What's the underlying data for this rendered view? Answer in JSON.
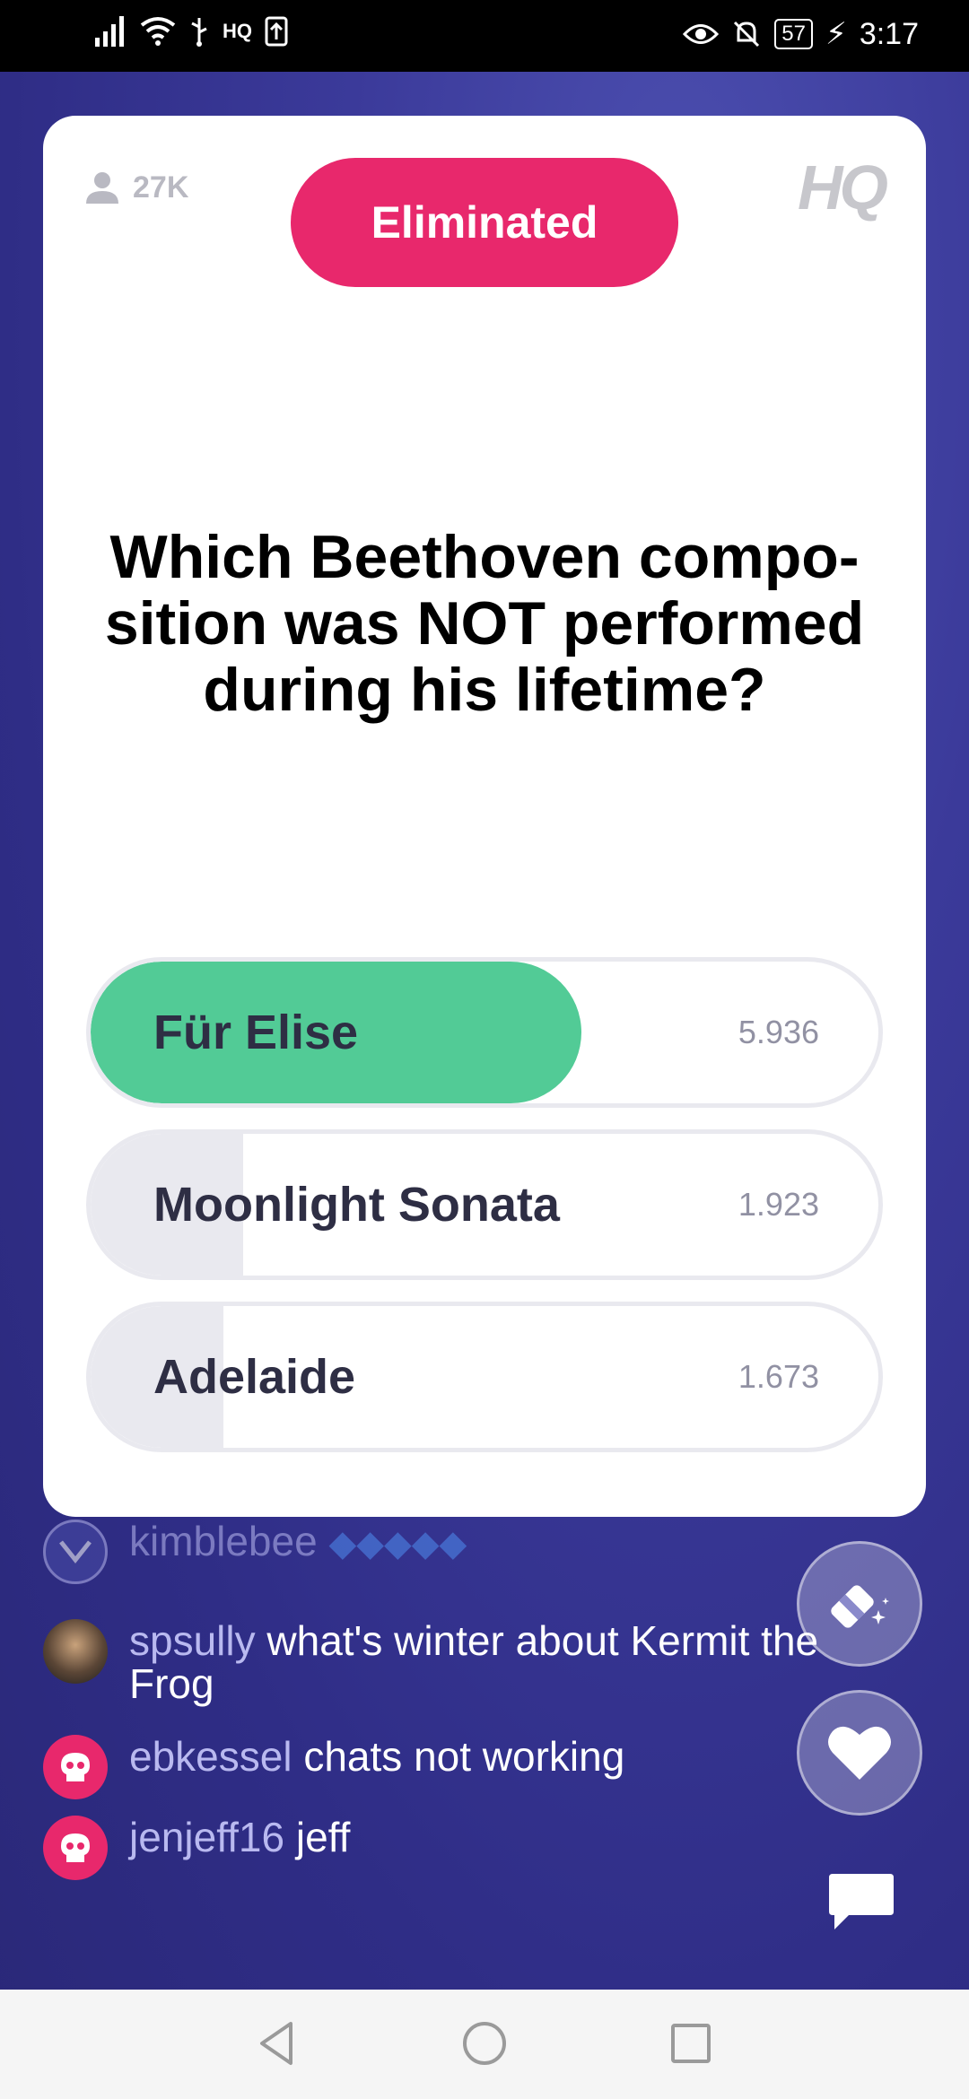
{
  "status_bar": {
    "network_label": "HQ",
    "battery_level": "57",
    "time": "3:17"
  },
  "card": {
    "viewers": "27K",
    "status_label": "Eliminated",
    "logo_text": "HQ",
    "question": "Which Beethoven compo-\nsition was NOT performed during his lifetime?",
    "answers": [
      {
        "label": "Für Elise",
        "count": "5.936",
        "share": 0.6225,
        "selected": true
      },
      {
        "label": "Moonlight Sonata",
        "count": "1.923",
        "share": 0.2017,
        "selected": false
      },
      {
        "label": "Adelaide",
        "count": "1.673",
        "share": 0.1755,
        "selected": false
      }
    ],
    "colors": {
      "eliminated": "#e8286c",
      "selected_fill": "#52cb96",
      "other_fill": "#e9e9ef"
    }
  },
  "chat": {
    "messages": [
      {
        "user": "kimblebee",
        "text": "",
        "avatar": "badge-icon"
      },
      {
        "user": "spsully",
        "text": "what's winter about Kermit the Frog",
        "avatar": "user-photo"
      },
      {
        "user": "ebkessel",
        "text": "chats not working",
        "avatar": "skull-icon"
      },
      {
        "user": "jenjeff16",
        "text": "jeff",
        "avatar": "skull-icon"
      }
    ]
  },
  "actions": {
    "eraser": "eraser-icon",
    "heart": "heart-icon",
    "chat": "chat-bubble-icon"
  }
}
